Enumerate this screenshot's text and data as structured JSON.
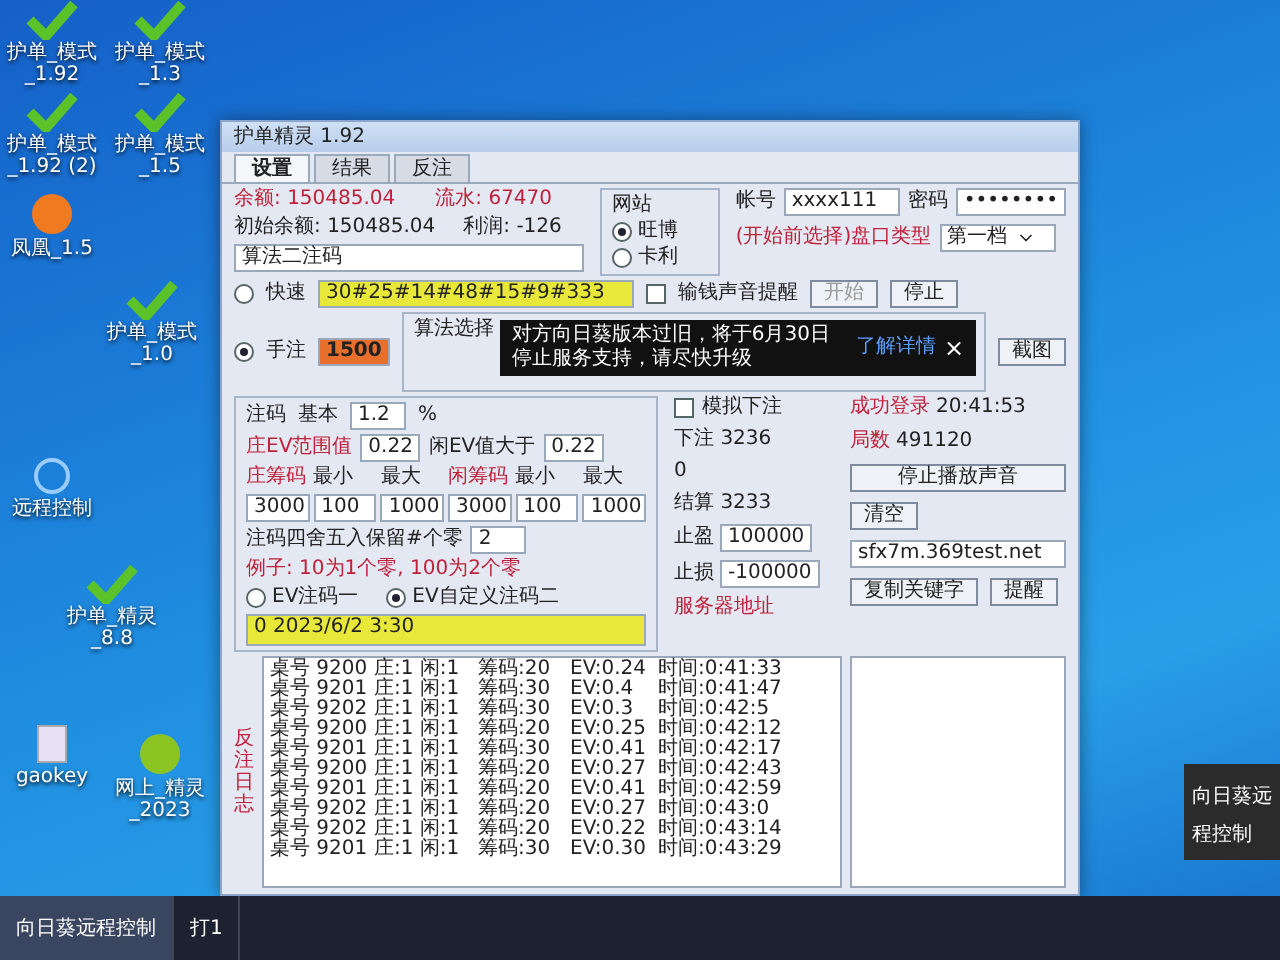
{
  "desktop_icons": [
    {
      "kind": "check",
      "label": "护单_模式_1.92"
    },
    {
      "kind": "check",
      "label": "护单_模式_1.3"
    },
    {
      "kind": "check",
      "label": "护单_模式_1.92 (2)"
    },
    {
      "kind": "check",
      "label": "护单_模式_1.5"
    },
    {
      "kind": "orb",
      "label": "凤凰_1.5"
    },
    {
      "kind": "check",
      "label": "护单_模式_1.0"
    },
    {
      "kind": "app",
      "label": "远程控制"
    },
    {
      "kind": "check",
      "label": "护单_精灵_8.8"
    },
    {
      "kind": "file",
      "label": "gaokey"
    },
    {
      "kind": "ball",
      "label": "网上_精灵_2023"
    }
  ],
  "window": {
    "title": "护单精灵 1.92",
    "tabs": [
      {
        "label": "设置",
        "selected": true
      },
      {
        "label": "结果",
        "selected": false
      },
      {
        "label": "反注",
        "selected": false
      }
    ],
    "balance": {
      "label": "余额:",
      "value": "150485.04"
    },
    "turnover": {
      "label": "流水:",
      "value": "67470"
    },
    "initial_balance": {
      "label": "初始余额:",
      "value": "150485.04"
    },
    "profit": {
      "label": "利润:",
      "value": "-126"
    },
    "algorithm_field": "算法二注码",
    "site_group": {
      "title": "网站",
      "options": [
        {
          "label": "旺博",
          "selected": true
        },
        {
          "label": "卡利",
          "selected": false
        }
      ]
    },
    "account": {
      "label": "帐号",
      "value": "xxxx111"
    },
    "password": {
      "label": "密码",
      "value": "••••••••"
    },
    "hint": "(开始前选择)盘口类型",
    "tier_select": "第一档",
    "sound_alert": {
      "label": "输钱声音提醒",
      "checked": false
    },
    "start_button": {
      "label": "开始",
      "disabled": true
    },
    "stop_button": "停止",
    "modes": [
      {
        "label": "快速",
        "selected": false,
        "value": "30#25#14#48#15#9#333"
      },
      {
        "label": "手注",
        "selected": true,
        "value": "1500"
      }
    ],
    "algorithm_group": "算法选择",
    "screenshot_button": "截图",
    "simulate": {
      "label": "模拟下注",
      "checked": false
    },
    "bet_group": {
      "title": "注码",
      "base": {
        "label": "基本",
        "value": "1.2",
        "unit": "%"
      },
      "banker_ev": {
        "label": "庄EV范围值",
        "value": "0.22"
      },
      "player_ev": {
        "label": "闲EV值大于",
        "value": "0.22"
      },
      "chip_headers": [
        "庄筹码",
        "最小",
        "最大",
        "闲筹码",
        "最小",
        "最大"
      ],
      "chip_values": [
        "3000",
        "100",
        "1000",
        "3000",
        "100",
        "1000"
      ],
      "rounding": {
        "label": "注码四舍五入保留#个零",
        "value": "2"
      },
      "rounding_example": "例子: 10为1个零, 100为2个零",
      "ev_modes": [
        {
          "label": "EV注码一",
          "selected": false
        },
        {
          "label": "EV自定义注码二",
          "selected": true
        }
      ]
    },
    "status_box": "0 2023/6/2 3:30",
    "bets": {
      "label": "下注",
      "value": "3236"
    },
    "zero": "0",
    "settled": {
      "label": "结算",
      "value": "3233"
    },
    "login": {
      "label": "成功登录",
      "value": "20:41:53"
    },
    "rounds": {
      "label": "局数",
      "value": "491120"
    },
    "stop_sound_button": "停止播放声音",
    "take_profit": {
      "label": "止盈",
      "value": "100000"
    },
    "stop_loss": {
      "label": "止损",
      "value": "-100000"
    },
    "clear_button": "清空",
    "server": {
      "label": "服务器地址",
      "value": "sfx7m.369test.net"
    },
    "copy_button": "复制关键字",
    "remind_button": "提醒",
    "log_label": "反注日志",
    "log_rows": [
      [
        "桌号 9200",
        "庄:1 闲:1",
        "筹码:20",
        "EV:0.24",
        "时间:0:41:33"
      ],
      [
        "桌号 9201",
        "庄:1 闲:1",
        "筹码:30",
        "EV:0.4",
        "时间:0:41:47"
      ],
      [
        "桌号 9202",
        "庄:1 闲:1",
        "筹码:30",
        "EV:0.3",
        "时间:0:42:5"
      ],
      [
        "桌号 9200",
        "庄:1 闲:1",
        "筹码:20",
        "EV:0.25",
        "时间:0:42:12"
      ],
      [
        "桌号 9201",
        "庄:1 闲:1",
        "筹码:30",
        "EV:0.41",
        "时间:0:42:17"
      ],
      [
        "桌号 9200",
        "庄:1 闲:1",
        "筹码:20",
        "EV:0.27",
        "时间:0:42:43"
      ],
      [
        "桌号 9201",
        "庄:1 闲:1",
        "筹码:20",
        "EV:0.41",
        "时间:0:42:59"
      ],
      [
        "桌号 9202",
        "庄:1 闲:1",
        "筹码:20",
        "EV:0.27",
        "时间:0:43:0"
      ],
      [
        "桌号 9202",
        "庄:1 闲:1",
        "筹码:20",
        "EV:0.22",
        "时间:0:43:14"
      ],
      [
        "桌号 9201",
        "庄:1 闲:1",
        "筹码:30",
        "EV:0.30",
        "时间:0:43:29"
      ]
    ]
  },
  "toast": {
    "message": "对方向日葵版本过旧，将于6月30日停止服务支持，请尽快升级",
    "link": "了解详情",
    "close": "×"
  },
  "notification": "向日葵远程控制",
  "taskbar": [
    {
      "label": "向日葵远程控制",
      "selected": true
    },
    {
      "label": "打1",
      "selected": false
    }
  ]
}
